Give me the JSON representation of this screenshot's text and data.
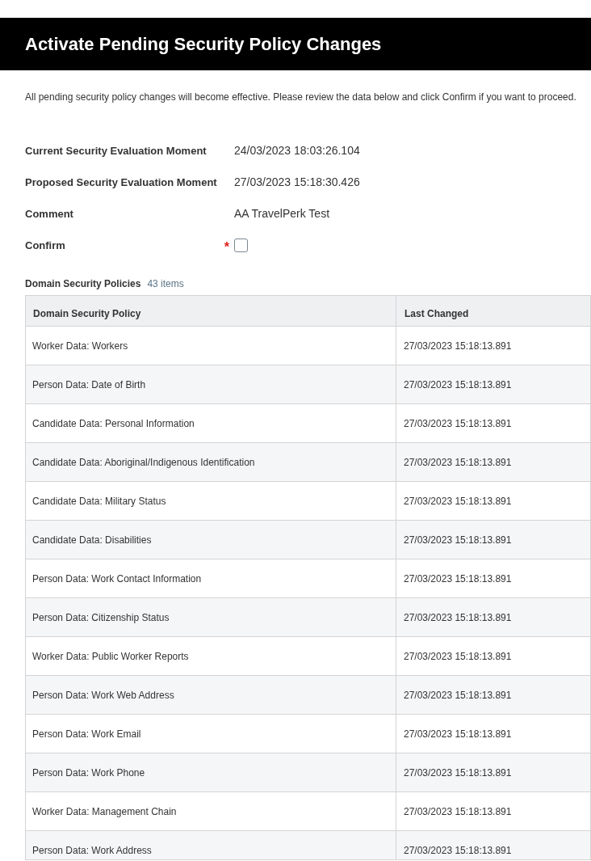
{
  "page": {
    "title": "Activate Pending Security Policy Changes",
    "description": "All pending security policy changes will become effective. Please review the data below and click Confirm if you want to proceed."
  },
  "fields": [
    {
      "kind": "text",
      "label": "Current Security Evaluation Moment",
      "value": "24/03/2023 18:03:26.104"
    },
    {
      "kind": "text",
      "label": "Proposed Security Evaluation Moment",
      "value": "27/03/2023 15:18:30.426"
    },
    {
      "kind": "text",
      "label": "Comment",
      "value": "AA TravelPerk Test"
    },
    {
      "kind": "checkbox",
      "label": "Confirm",
      "required_mark": "*",
      "checked": false
    }
  ],
  "table": {
    "title": "Domain Security Policies",
    "count": "43 items",
    "columns": [
      "Domain Security Policy",
      "Last Changed"
    ],
    "rows": [
      [
        "Worker Data: Workers",
        "27/03/2023 15:18:13.891"
      ],
      [
        "Person Data: Date of Birth",
        "27/03/2023 15:18:13.891"
      ],
      [
        "Candidate Data: Personal Information",
        "27/03/2023 15:18:13.891"
      ],
      [
        "Candidate Data: Aboriginal/Indigenous Identification",
        "27/03/2023 15:18:13.891"
      ],
      [
        "Candidate Data: Military Status",
        "27/03/2023 15:18:13.891"
      ],
      [
        "Candidate Data: Disabilities",
        "27/03/2023 15:18:13.891"
      ],
      [
        "Person Data: Work Contact Information",
        "27/03/2023 15:18:13.891"
      ],
      [
        "Person Data: Citizenship Status",
        "27/03/2023 15:18:13.891"
      ],
      [
        "Worker Data: Public Worker Reports",
        "27/03/2023 15:18:13.891"
      ],
      [
        "Person Data: Work Web Address",
        "27/03/2023 15:18:13.891"
      ],
      [
        "Person Data: Work Email",
        "27/03/2023 15:18:13.891"
      ],
      [
        "Person Data: Work Phone",
        "27/03/2023 15:18:13.891"
      ],
      [
        "Worker Data: Management Chain",
        "27/03/2023 15:18:13.891"
      ],
      [
        "Person Data: Work Address",
        "27/03/2023 15:18:13.891"
      ]
    ]
  }
}
